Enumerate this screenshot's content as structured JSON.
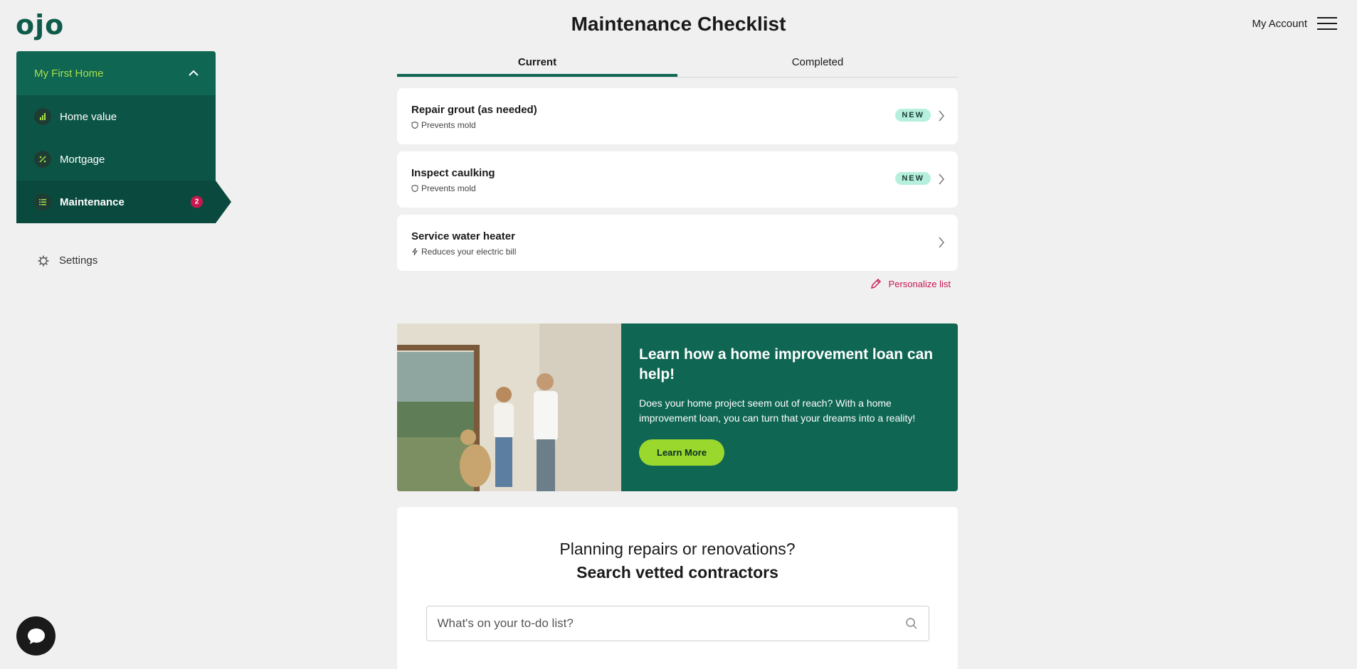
{
  "brand": {
    "logo": "ojo",
    "color": "#0f5b4b",
    "accent": "#a6e04a",
    "alert": "#c8174f"
  },
  "header": {
    "title": "Maintenance Checklist",
    "account_label": "My Account",
    "menu_icon": "hamburger-icon"
  },
  "sidebar": {
    "home_name": "My First Home",
    "items": [
      {
        "label": "Home value",
        "icon": "bar-chart-icon"
      },
      {
        "label": "Mortgage",
        "icon": "percent-icon"
      },
      {
        "label": "Maintenance",
        "icon": "checklist-icon",
        "badge": "2",
        "active": true
      }
    ],
    "settings_label": "Settings"
  },
  "tabs": [
    {
      "label": "Current",
      "active": true
    },
    {
      "label": "Completed",
      "active": false
    }
  ],
  "tasks": [
    {
      "title": "Repair grout (as needed)",
      "subtitle": "Prevents mold",
      "icon": "shield-icon",
      "badge": "NEW"
    },
    {
      "title": "Inspect caulking",
      "subtitle": "Prevents mold",
      "icon": "shield-icon",
      "badge": "NEW"
    },
    {
      "title": "Service water heater",
      "subtitle": "Reduces your electric bill",
      "icon": "bolt-icon",
      "badge": ""
    }
  ],
  "personalize_label": "Personalize list",
  "promo": {
    "title": "Learn how a home improvement loan can help!",
    "text": "Does your home project seem out of reach? With a home improvement loan, you can turn that your dreams into a reality!",
    "button": "Learn More"
  },
  "contractors": {
    "line1": "Planning repairs or renovations?",
    "line2": "Search vetted contractors",
    "placeholder": "What's on your to-do list?"
  }
}
